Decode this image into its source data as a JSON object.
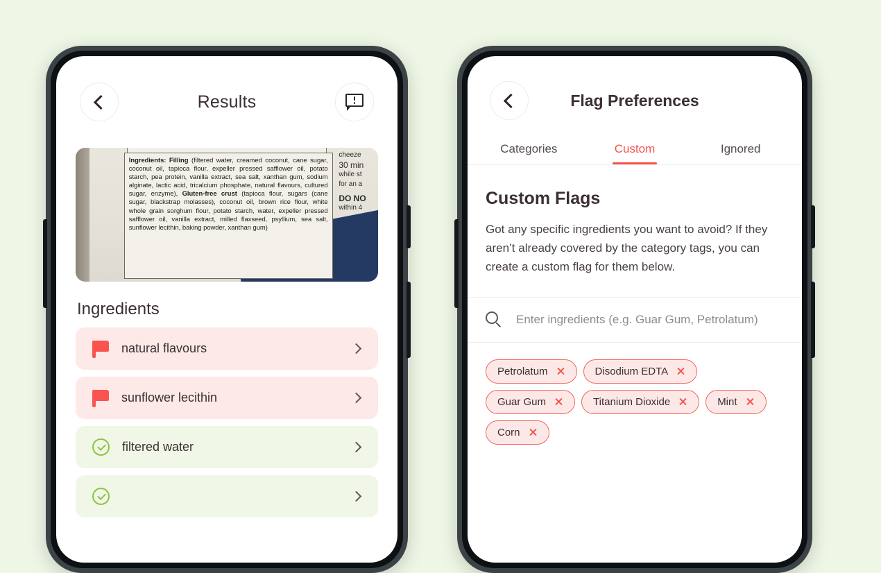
{
  "theme": {
    "page_background": "#eef6e5",
    "accent_red": "#f4554e",
    "flag_red": "#f9544f",
    "safe_green": "#8cc540",
    "flag_row_bg": "#fde9e8",
    "safe_row_bg": "#f0f7e7",
    "chip_bg": "#fce9e7",
    "chip_border": "#f4655e",
    "text_dark": "#3b2f31",
    "bezel_outer": "#3b4347",
    "bezel_inner": "#0d1114"
  },
  "left_phone": {
    "topbar": {
      "back_icon": "chevron-left-icon",
      "title": "Results",
      "feedback_icon": "speech-bubble-alert-icon"
    },
    "label_photo": {
      "alt": "photo-of-packaging-ingredients-label",
      "ingredients_heading": "Ingredients: Filling",
      "filling_text": " (filtered water, creamed coconut, cane sugar, coconut oil, tapioca flour, expeller pressed safflower oil, potato starch, pea protein, vanilla extract, sea salt, xanthan gum, sodium alginate, lactic acid, tricalcium phosphate, natural flavours, cultured sugar, enzyme), ",
      "crust_heading": "Gluten-free crust",
      "crust_text": " (tapioca flour, sugars (cane sugar, blackstrap molasses), coconut oil, brown rice flour, white whole grain sorghum flour, potato starch, water, expeller pressed safflower oil, vanilla extract, milled flaxseed, psyllium, sea salt, sunflower lecithin, baking powder, xanthan gum)",
      "side_column": [
        "cheeze",
        "30 min",
        "while st",
        "for an a",
        "DO NO",
        "within 4"
      ]
    },
    "section_title": "Ingredients",
    "ingredients": [
      {
        "name": "natural flavours",
        "status": "flagged",
        "icon": "flag-icon",
        "chevron": "chevron-right-icon"
      },
      {
        "name": "sunflower lecithin",
        "status": "flagged",
        "icon": "flag-icon",
        "chevron": "chevron-right-icon"
      },
      {
        "name": "filtered water",
        "status": "safe",
        "icon": "check-circle-icon",
        "chevron": "chevron-right-icon"
      },
      {
        "name": "",
        "status": "safe",
        "icon": "check-circle-icon",
        "chevron": "chevron-right-icon"
      }
    ]
  },
  "right_phone": {
    "topbar": {
      "back_icon": "chevron-left-icon",
      "title": "Flag Preferences"
    },
    "tabs": [
      {
        "label": "Categories",
        "active": false
      },
      {
        "label": "Custom",
        "active": true
      },
      {
        "label": "Ignored",
        "active": false
      }
    ],
    "section": {
      "heading": "Custom Flags",
      "description": "Got any specific ingredients you want to avoid? If they aren’t already covered by the category tags, you can create a custom flag for them below."
    },
    "search": {
      "icon": "search-icon",
      "placeholder": "Enter ingredients (e.g. Guar Gum, Petrolatum)",
      "value": ""
    },
    "chips": [
      {
        "label": "Petrolatum",
        "remove_icon": "close-icon"
      },
      {
        "label": "Disodium EDTA",
        "remove_icon": "close-icon"
      },
      {
        "label": "Guar Gum",
        "remove_icon": "close-icon"
      },
      {
        "label": "Titanium Dioxide",
        "remove_icon": "close-icon"
      },
      {
        "label": "Mint",
        "remove_icon": "close-icon"
      },
      {
        "label": "Corn",
        "remove_icon": "close-icon"
      }
    ]
  }
}
